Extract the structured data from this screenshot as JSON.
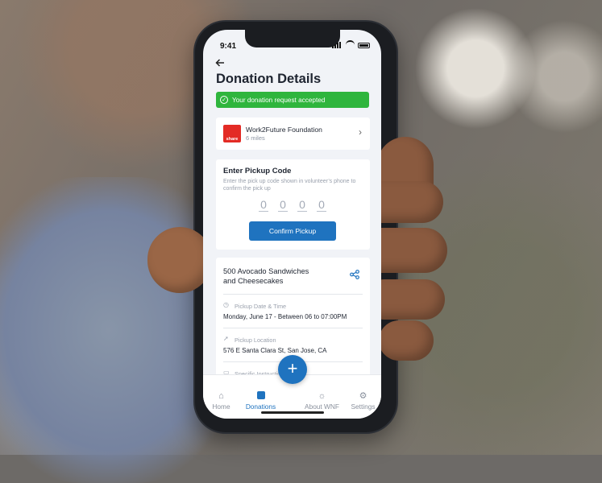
{
  "status_bar": {
    "time": "9:41"
  },
  "header": {
    "back_icon": "arrow-left-icon",
    "title": "Donation Details"
  },
  "banner": {
    "text": "Your donation request accepted",
    "color": "#2fb53d"
  },
  "organization": {
    "logo_text": "share",
    "name": "Work2Future Foundation",
    "distance": "6 miles"
  },
  "pickup": {
    "title": "Enter Pickup Code",
    "description": "Enter the pick up code shown in volunteer’s phone to confirm the pick up",
    "digits": [
      "0",
      "0",
      "0",
      "0"
    ],
    "confirm_label": "Confirm Pickup"
  },
  "donation": {
    "title_line1": "500 Avocado Sandwiches",
    "title_line2": "and  Cheesecakes",
    "fields": [
      {
        "icon": "clock-icon",
        "label": "Pickup Date & Time",
        "value": "Monday, June 17 - Between 06 to 07:00PM"
      },
      {
        "icon": "location-arrow-icon",
        "label": "Pickup Location",
        "value": "576 E Santa Clara St, San Jose, CA"
      },
      {
        "icon": "book-icon",
        "label": "Specific Instructions",
        "value": ""
      }
    ]
  },
  "tabbar": {
    "tabs": [
      {
        "label": "Home",
        "icon": "home-icon"
      },
      {
        "label": "Donations",
        "icon": "donations-icon"
      },
      {
        "label": "About WNF",
        "icon": "sun-icon"
      },
      {
        "label": "Settings",
        "icon": "gear-icon"
      }
    ],
    "active_color": "#1f73bf"
  }
}
